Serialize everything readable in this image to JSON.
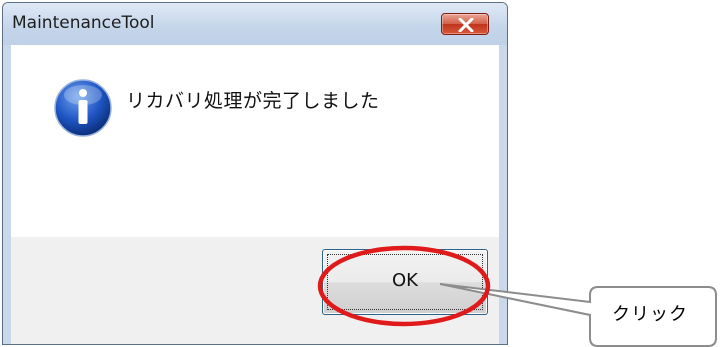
{
  "window": {
    "title": "MaintenanceTool",
    "close_icon": "close-icon"
  },
  "dialog": {
    "icon": "info-icon",
    "message": "リカバリ処理が完了しました",
    "ok_label": "OK"
  },
  "annotation": {
    "text": "クリック",
    "highlight_color": "#e01a1a"
  }
}
